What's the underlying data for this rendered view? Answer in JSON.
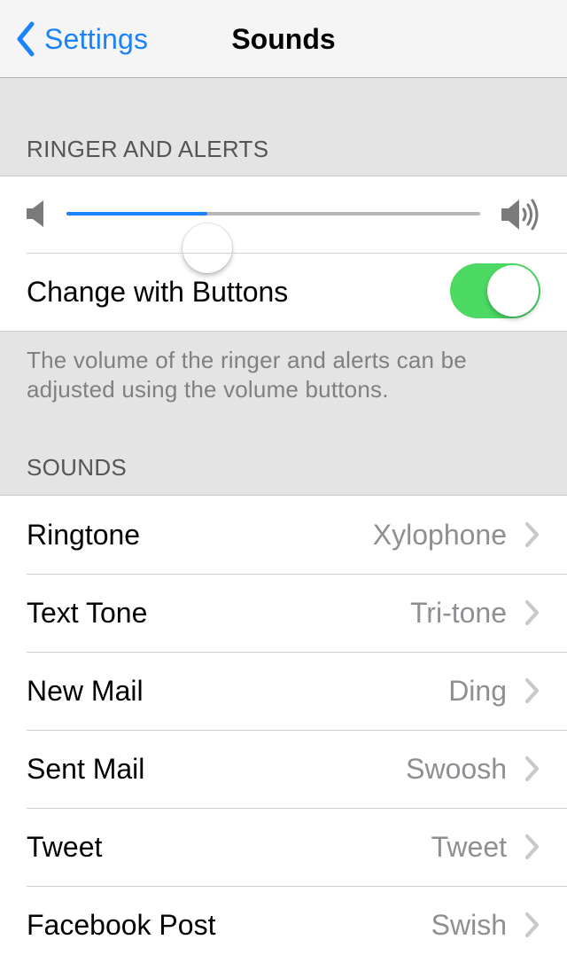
{
  "nav": {
    "back_label": "Settings",
    "title": "Sounds"
  },
  "ringer": {
    "header": "RINGER AND ALERTS",
    "volume_level": 0.34,
    "change_with_buttons_label": "Change with Buttons",
    "change_with_buttons_on": true,
    "footer": "The volume of the ringer and alerts can be adjusted using the volume buttons."
  },
  "sounds": {
    "header": "SOUNDS",
    "items": [
      {
        "label": "Ringtone",
        "value": "Xylophone"
      },
      {
        "label": "Text Tone",
        "value": "Tri-tone"
      },
      {
        "label": "New Mail",
        "value": "Ding"
      },
      {
        "label": "Sent Mail",
        "value": "Swoosh"
      },
      {
        "label": "Tweet",
        "value": "Tweet"
      },
      {
        "label": "Facebook Post",
        "value": "Swish"
      }
    ]
  },
  "colors": {
    "accent": "#1a82fb",
    "toggle_on": "#4cd964",
    "background": "#e4e4e4"
  },
  "icons": {
    "back": "chevron-left-icon",
    "volume_low": "speaker-low-icon",
    "volume_high": "speaker-high-icon",
    "disclosure": "chevron-right-icon"
  }
}
